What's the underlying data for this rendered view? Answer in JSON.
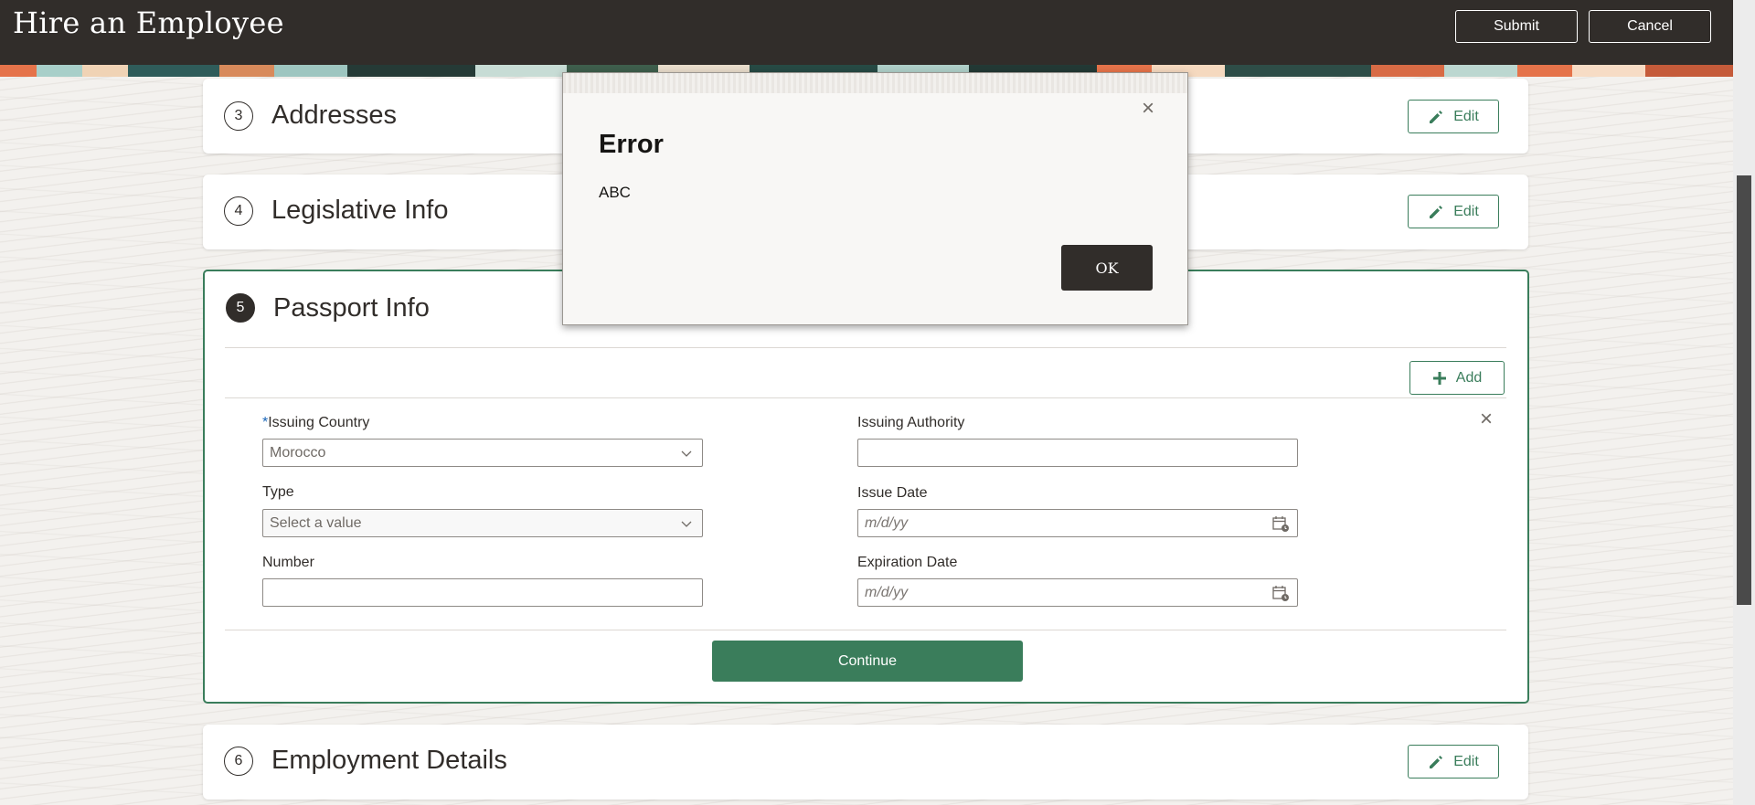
{
  "header": {
    "title": "Hire an Employee",
    "submit_label": "Submit",
    "cancel_label": "Cancel"
  },
  "sections": {
    "addresses": {
      "number": "3",
      "title": "Addresses",
      "edit_label": "Edit"
    },
    "legislative": {
      "number": "4",
      "title": "Legislative Info",
      "edit_label": "Edit"
    },
    "passport": {
      "number": "5",
      "title": "Passport Info",
      "add_label": "Add",
      "continue_label": "Continue"
    },
    "employment": {
      "number": "6",
      "title": "Employment Details",
      "edit_label": "Edit"
    }
  },
  "passport_form": {
    "issuing_country": {
      "required_mark": "*",
      "label": "Issuing Country",
      "value": "Morocco"
    },
    "issuing_authority": {
      "label": "Issuing Authority",
      "value": ""
    },
    "type": {
      "label": "Type",
      "placeholder": "Select a value"
    },
    "issue_date": {
      "label": "Issue Date",
      "placeholder": "m/d/yy"
    },
    "number": {
      "label": "Number",
      "value": ""
    },
    "expiration_date": {
      "label": "Expiration Date",
      "placeholder": "m/d/yy"
    }
  },
  "dialog": {
    "title": "Error",
    "message": "ABC",
    "ok_label": "OK",
    "close_glyph": "×"
  },
  "icons": {
    "close": "close-icon",
    "edit": "pencil-icon",
    "add": "plus-icon",
    "dropdown": "chevron-down-icon",
    "calendar": "calendar-icon"
  },
  "colors": {
    "header_bg": "#312d2a",
    "accent_green": "#3a7d5b",
    "required_blue": "#1a66b8"
  }
}
